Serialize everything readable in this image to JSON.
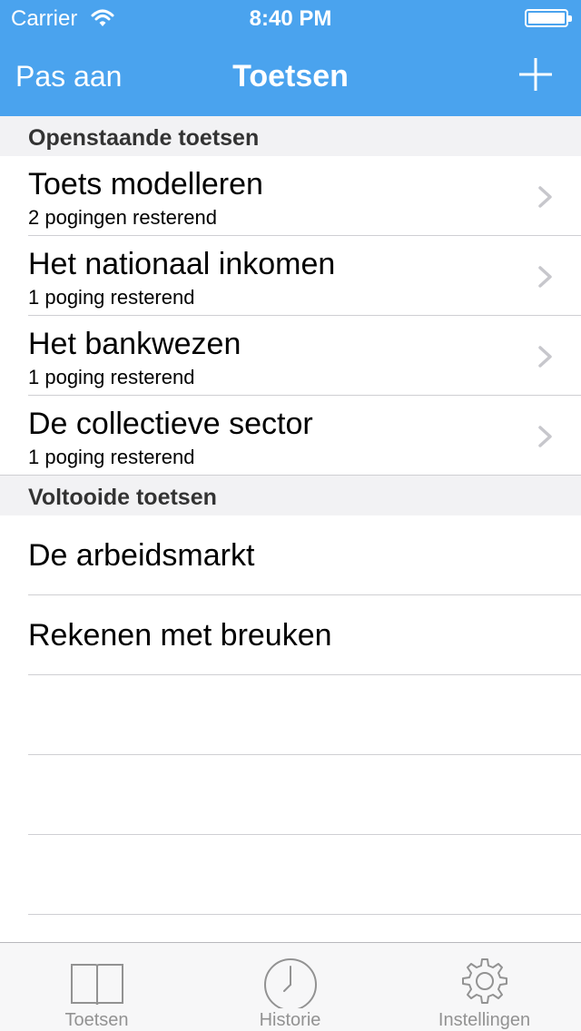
{
  "status_bar": {
    "carrier": "Carrier",
    "time": "8:40 PM"
  },
  "nav": {
    "edit_label": "Pas aan",
    "title": "Toetsen",
    "add_icon": "plus-icon"
  },
  "colors": {
    "nav_background": "#4aa3ee",
    "section_background": "#f2f2f4",
    "tab_inactive": "#929292"
  },
  "sections": {
    "open": {
      "header": "Openstaande toetsen",
      "items": [
        {
          "title": "Toets modelleren",
          "subtitle": "2 pogingen resterend"
        },
        {
          "title": "Het nationaal inkomen",
          "subtitle": "1 poging resterend"
        },
        {
          "title": "Het bankwezen",
          "subtitle": "1 poging resterend"
        },
        {
          "title": "De collectieve sector",
          "subtitle": "1 poging resterend"
        }
      ]
    },
    "completed": {
      "header": "Voltooide toetsen",
      "items": [
        {
          "title": "De arbeidsmarkt"
        },
        {
          "title": "Rekenen met breuken"
        }
      ]
    }
  },
  "tab_bar": {
    "tabs": [
      {
        "label": "Toetsen",
        "icon": "book-icon"
      },
      {
        "label": "Historie",
        "icon": "clock-icon"
      },
      {
        "label": "Instellingen",
        "icon": "gear-icon"
      }
    ]
  }
}
